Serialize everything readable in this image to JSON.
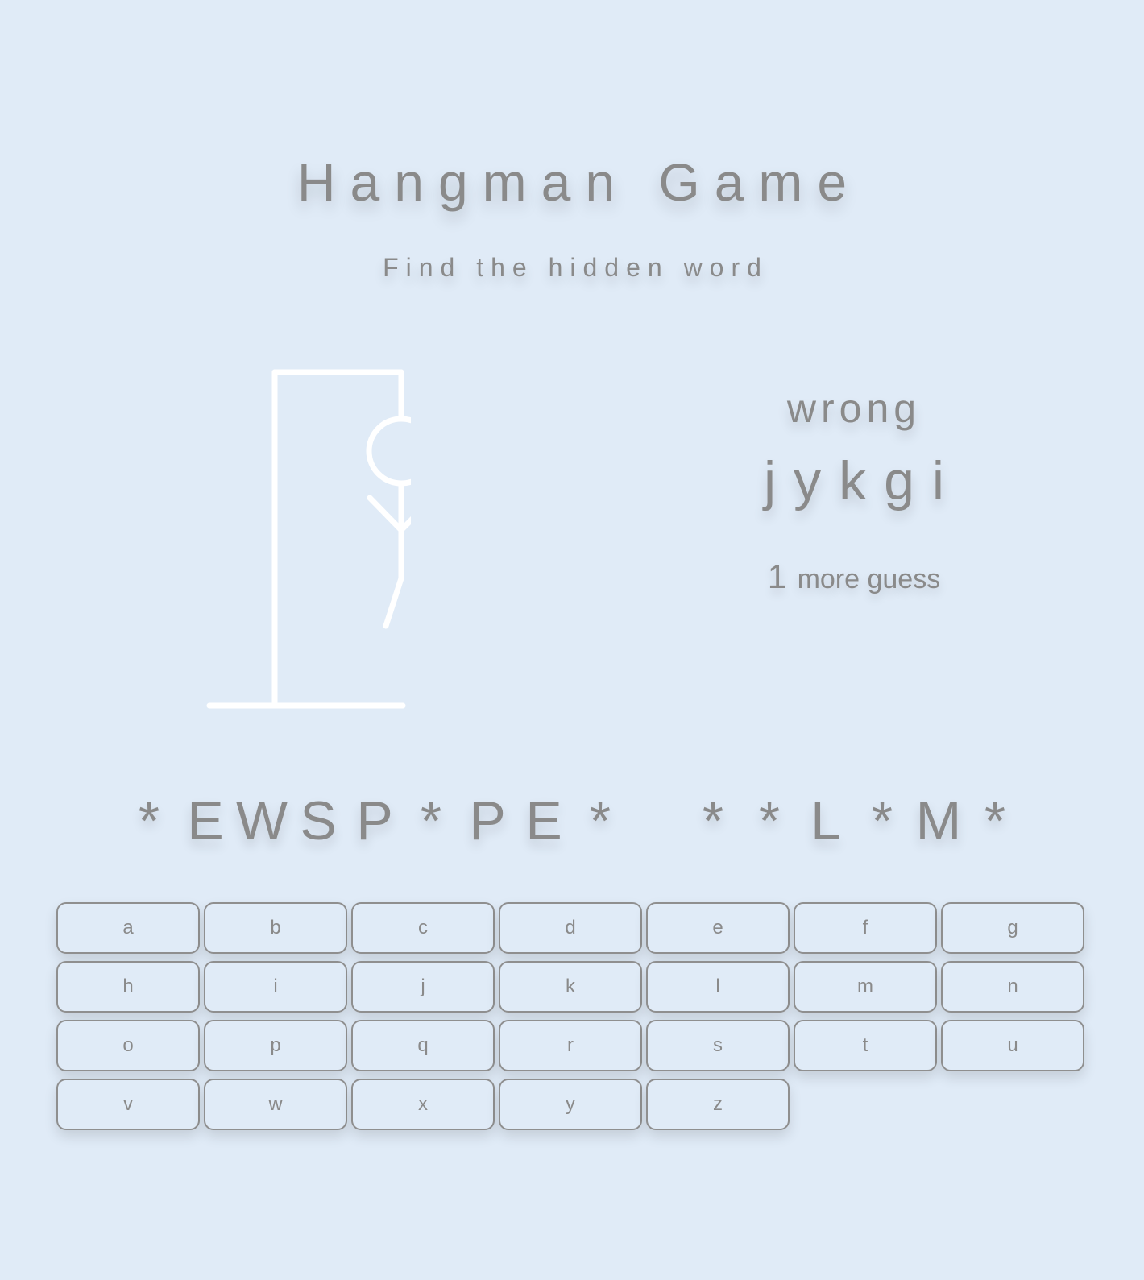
{
  "header": {
    "title": "Hangman Game",
    "subtitle": "Find the hidden word"
  },
  "status": {
    "wrong_label": "wrong",
    "wrong_letters": [
      "j",
      "y",
      "k",
      "g",
      "i"
    ],
    "guesses_left": "1",
    "guesses_left_text": "more guess",
    "figure_parts_shown": [
      "head",
      "body",
      "left-arm",
      "right-arm",
      "left-leg"
    ]
  },
  "word": {
    "display": [
      "*",
      "E",
      "W",
      "S",
      "P",
      "*",
      "P",
      "E",
      "*",
      " ",
      "*",
      "*",
      "L",
      "*",
      "M",
      "*"
    ]
  },
  "keyboard": {
    "keys": [
      "a",
      "b",
      "c",
      "d",
      "e",
      "f",
      "g",
      "h",
      "i",
      "j",
      "k",
      "l",
      "m",
      "n",
      "o",
      "p",
      "q",
      "r",
      "s",
      "t",
      "u",
      "v",
      "w",
      "x",
      "y",
      "z"
    ]
  },
  "colors": {
    "background": "#e0ebf7",
    "text": "#8a8a8a",
    "drawing": "#ffffff"
  }
}
